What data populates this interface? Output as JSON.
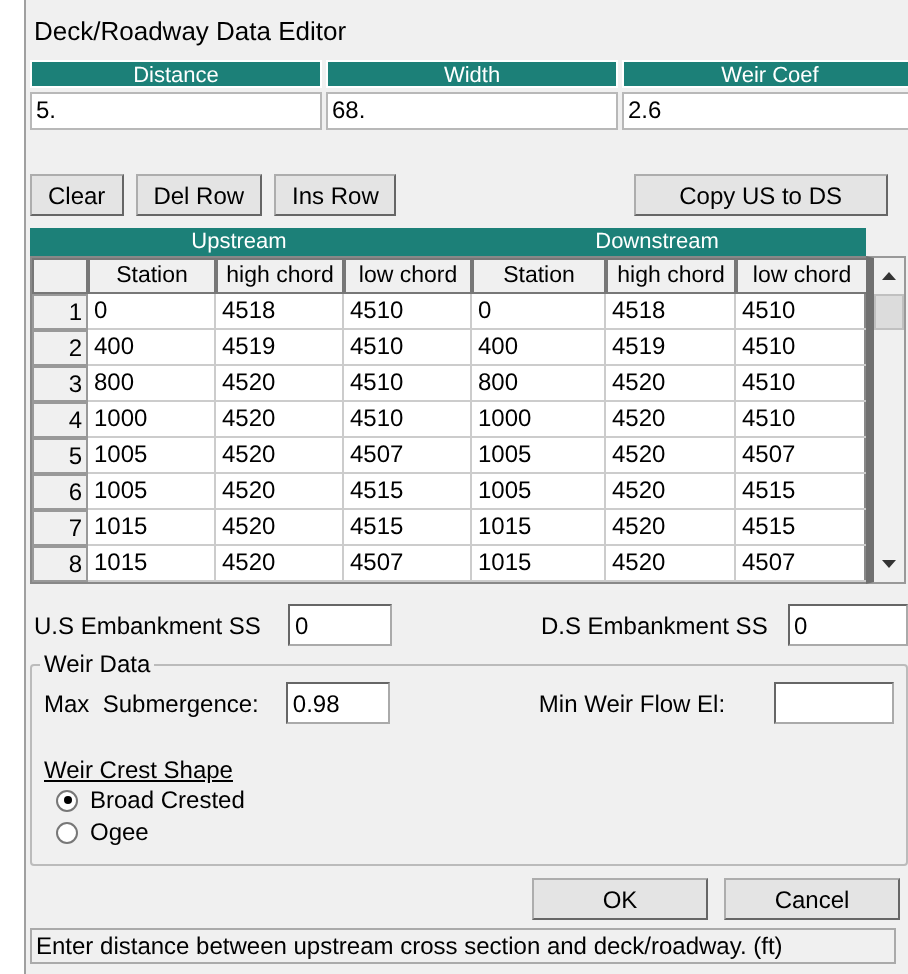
{
  "window": {
    "title": "Deck/Roadway Data Editor"
  },
  "deck_fields": [
    {
      "label": "Distance",
      "value": "5."
    },
    {
      "label": "Width",
      "value": "68."
    },
    {
      "label": "Weir Coef",
      "value": "2.6"
    }
  ],
  "toolbar_left": [
    "Clear",
    "Del Row",
    "Ins Row"
  ],
  "toolbar_right": [
    "Copy US to DS"
  ],
  "table": {
    "groups": [
      "Upstream",
      "Downstream"
    ],
    "columns": [
      "Station",
      "high chord",
      "low chord",
      "Station",
      "high chord",
      "low chord"
    ],
    "rows": [
      {
        "number": "1",
        "cells": [
          "0",
          "4518",
          "4510",
          "0",
          "4518",
          "4510"
        ]
      },
      {
        "number": "2",
        "cells": [
          "400",
          "4519",
          "4510",
          "400",
          "4519",
          "4510"
        ]
      },
      {
        "number": "3",
        "cells": [
          "800",
          "4520",
          "4510",
          "800",
          "4520",
          "4510"
        ]
      },
      {
        "number": "4",
        "cells": [
          "1000",
          "4520",
          "4510",
          "1000",
          "4520",
          "4510"
        ]
      },
      {
        "number": "5",
        "cells": [
          "1005",
          "4520",
          "4507",
          "1005",
          "4520",
          "4507"
        ]
      },
      {
        "number": "6",
        "cells": [
          "1005",
          "4520",
          "4515",
          "1005",
          "4520",
          "4515"
        ]
      },
      {
        "number": "7",
        "cells": [
          "1015",
          "4520",
          "4515",
          "1015",
          "4520",
          "4515"
        ]
      },
      {
        "number": "8",
        "cells": [
          "1015",
          "4520",
          "4507",
          "1015",
          "4520",
          "4507"
        ]
      }
    ]
  },
  "embankment": [
    {
      "label": "U.S Embankment SS",
      "value": "0"
    },
    {
      "label": "D.S Embankment SS",
      "value": "0"
    }
  ],
  "weir_data": {
    "title": "Weir Data",
    "max_submergence": {
      "label": "Max  Submergence:",
      "value": "0.98"
    },
    "min_weir_flow": {
      "label": "Min Weir Flow El:"
    },
    "crest_shape": {
      "title": "Weir Crest Shape",
      "options": [
        {
          "label": "Broad Crested",
          "selected": true
        },
        {
          "label": "Ogee",
          "selected": false
        }
      ]
    }
  },
  "dialog_buttons": [
    "OK",
    "Cancel"
  ],
  "status_bar": "Enter distance between upstream cross section and deck/roadway. (ft)"
}
